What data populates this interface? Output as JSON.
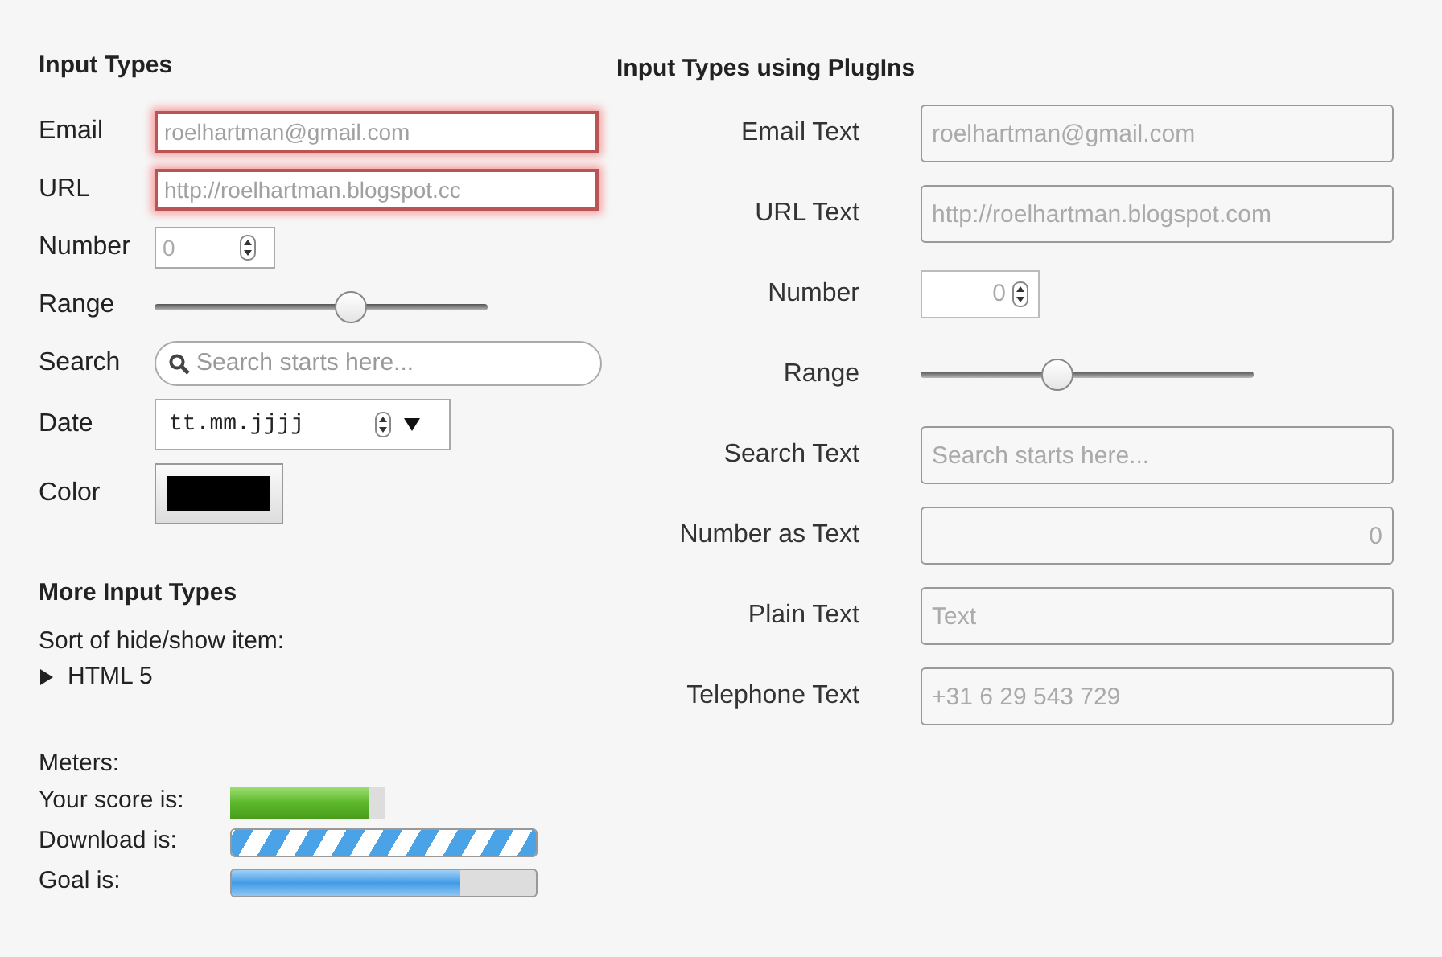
{
  "left": {
    "title": "Input Types",
    "fields": [
      {
        "kind": "email",
        "label": "Email",
        "placeholder": "roelhartman@gmail.com",
        "invalid": true
      },
      {
        "kind": "url",
        "label": "URL",
        "placeholder": "http://roelhartman.blogspot.cc",
        "invalid": true
      },
      {
        "kind": "number",
        "label": "Number",
        "placeholder": "0"
      },
      {
        "kind": "range",
        "label": "Range",
        "level": 0.59
      },
      {
        "kind": "search",
        "label": "Search",
        "placeholder": "Search starts here..."
      },
      {
        "kind": "date",
        "label": "Date",
        "placeholder": "tt.mm.jjjj"
      },
      {
        "kind": "color",
        "label": "Color",
        "color": "#000000"
      }
    ]
  },
  "more": {
    "title": "More Input Types",
    "details_caption": "Sort of hide/show item:",
    "details": {
      "summary": "HTML 5",
      "expanded": false
    },
    "meters_title": "Meters:",
    "meters": [
      {
        "kind": "meter",
        "label": "Your score is:",
        "level": 0.9
      },
      {
        "kind": "indeterminate",
        "label": "Download is:",
        "level": 1
      },
      {
        "kind": "progress",
        "label": "Goal is:",
        "level": 0.75
      }
    ]
  },
  "right": {
    "title": "Input Types using PlugIns",
    "fields": [
      {
        "kind": "text",
        "label": "Email Text",
        "placeholder": "roelhartman@gmail.com"
      },
      {
        "kind": "text",
        "label": "URL Text",
        "placeholder": "http://roelhartman.blogspot.com"
      },
      {
        "kind": "number",
        "label": "Number",
        "placeholder": "0"
      },
      {
        "kind": "range",
        "label": "Range",
        "level": 0.41
      },
      {
        "kind": "text",
        "label": "Search Text",
        "placeholder": "Search starts here..."
      },
      {
        "kind": "numtext",
        "label": "Number as Text",
        "placeholder": "0"
      },
      {
        "kind": "text",
        "label": "Plain Text",
        "placeholder": "Text"
      },
      {
        "kind": "text",
        "label": "Telephone Text",
        "placeholder": "+31 6 29 543 729"
      }
    ]
  }
}
